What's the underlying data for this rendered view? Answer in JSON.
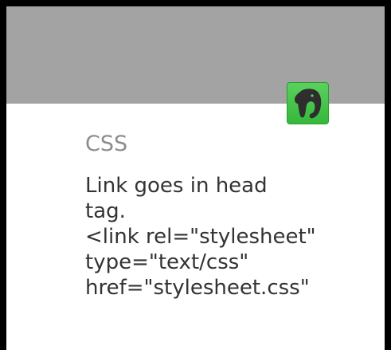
{
  "card": {
    "title": "CSS",
    "body": "Link goes in head\ntag.\n<link rel=\"stylesheet\"\ntype=\"text/css\"\nhref=\"stylesheet.css\""
  },
  "app_icon": {
    "name": "evernote-elephant-icon"
  },
  "colors": {
    "header": "#a3a3a3",
    "badge_green": "#3fbf44",
    "title_text": "#8c8c8c",
    "body_text": "#333333",
    "frame": "#000000"
  }
}
